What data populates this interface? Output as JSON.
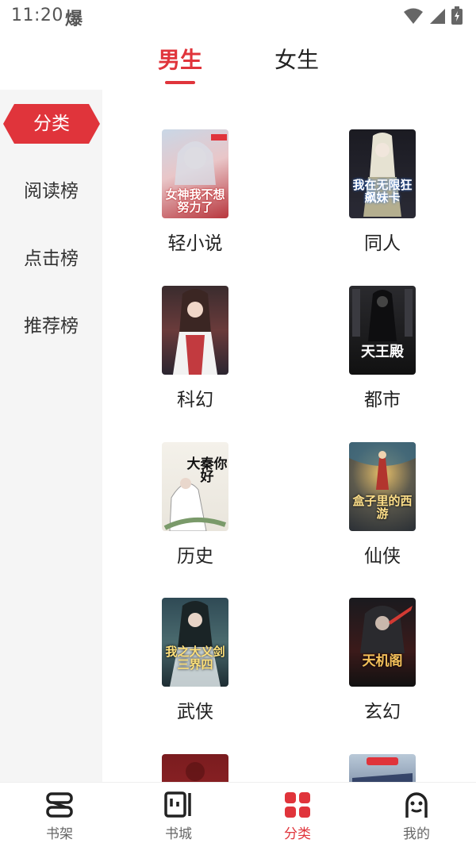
{
  "status": {
    "time": "11:20",
    "flag_glyph": "爆",
    "icons": [
      "wifi-icon",
      "signal-icon",
      "battery-icon"
    ]
  },
  "gender_tabs": [
    {
      "label": "男生",
      "active": true
    },
    {
      "label": "女生",
      "active": false
    }
  ],
  "side_nav": [
    {
      "label": "分类",
      "active": true
    },
    {
      "label": "阅读榜",
      "active": false
    },
    {
      "label": "点击榜",
      "active": false
    },
    {
      "label": "推荐榜",
      "active": false
    }
  ],
  "categories": [
    {
      "label": "轻小说",
      "cover_title": "女神我不想努力了"
    },
    {
      "label": "同人",
      "cover_title": "我在无限狂飙妹卡"
    },
    {
      "label": "科幻",
      "cover_title": ""
    },
    {
      "label": "都市",
      "cover_title": "天王殿"
    },
    {
      "label": "历史",
      "cover_title": "大秦你好"
    },
    {
      "label": "仙侠",
      "cover_title": "盒子里的西游"
    },
    {
      "label": "武侠",
      "cover_title": "我之大义剑三界四"
    },
    {
      "label": "玄幻",
      "cover_title": "天机阁"
    },
    {
      "label": "",
      "cover_title": ""
    },
    {
      "label": "",
      "cover_title": ""
    }
  ],
  "bottom_nav": [
    {
      "label": "书架",
      "icon": "bookshelf-icon",
      "active": false
    },
    {
      "label": "书城",
      "icon": "bookstore-icon",
      "active": false
    },
    {
      "label": "分类",
      "icon": "category-icon",
      "active": true
    },
    {
      "label": "我的",
      "icon": "profile-icon",
      "active": false
    }
  ],
  "colors": {
    "accent": "#e0343b",
    "sidebar_bg": "#f5f5f5"
  }
}
